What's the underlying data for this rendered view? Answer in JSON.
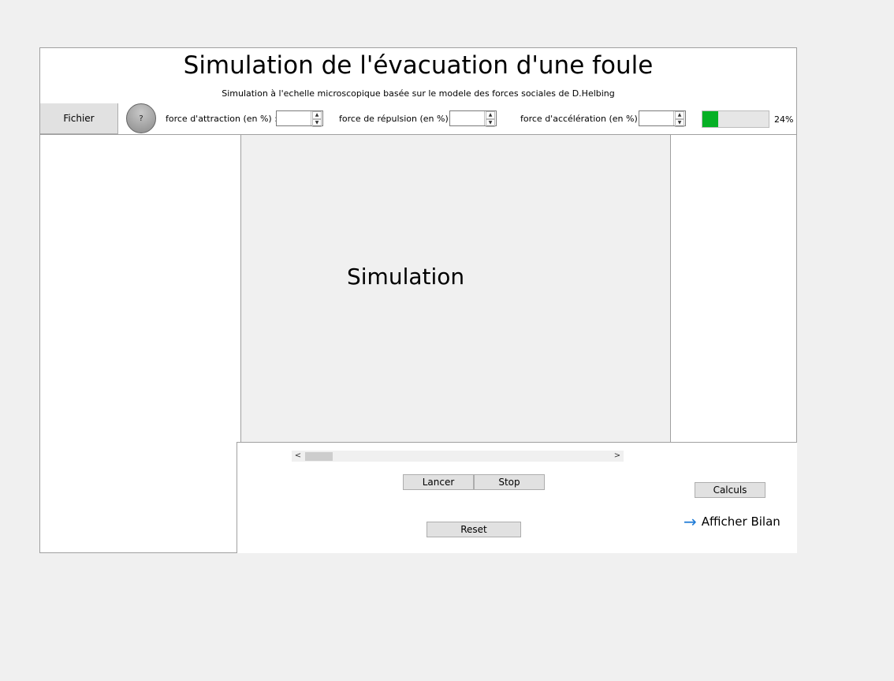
{
  "header": {
    "title": "Simulation de l'évacuation d'une foule",
    "subtitle": "Simulation à l'echelle microscopique basée sur le modele des forces sociales de D.Helbing"
  },
  "toolbar": {
    "fichier_label": "Fichier",
    "help_label": "?",
    "attraction_label": "force d'attraction (en %) :",
    "attraction_value": "",
    "repulsion_label": "force de répulsion (en %) :",
    "repulsion_value": "",
    "acceleration_label": "force d'accélération (en %) :",
    "acceleration_value": "",
    "progress_value": 24,
    "progress_label": "24%"
  },
  "simulation": {
    "label": "Simulation"
  },
  "controls": {
    "scroll_left": "<",
    "scroll_right": ">",
    "lancer_label": "Lancer",
    "stop_label": "Stop",
    "reset_label": "Reset",
    "calculs_label": "Calculs",
    "bilan_label": "Afficher Bilan",
    "bilan_icon": "arrow-right-icon"
  },
  "colors": {
    "progress_fill": "#06b025",
    "link_arrow": "#1e7ad6"
  }
}
